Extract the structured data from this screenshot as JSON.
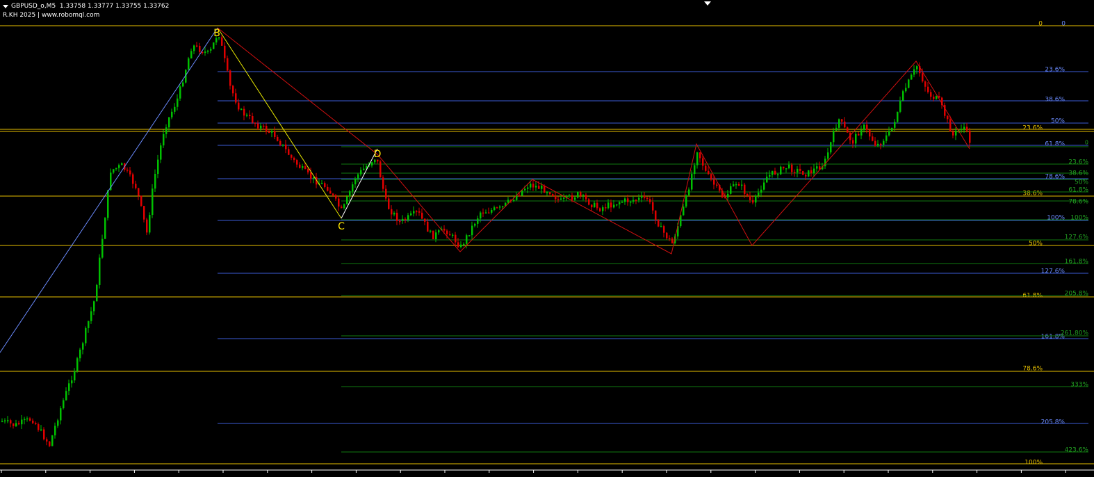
{
  "header": {
    "symbol": "GBPUSD_o,M5",
    "ohlc": "1.33758 1.33777 1.33755 1.33762",
    "watermark": "R.KH 2025 | www.robomql.com"
  },
  "colors": {
    "background": "#000000",
    "bull": "#00c000",
    "bear": "#e00000",
    "fib_gold": "#e8c100",
    "fib_blue": "#3b5bd6",
    "fib_blue_text": "#6b8cff",
    "fib_green": "#0f7a0f",
    "fib_green_text": "#22a022",
    "zigzag": "#d01010",
    "xa_line": "#6b8cff",
    "bc_line": "#e8e800",
    "cd_line": "#ffffff",
    "pattern_label": "#ffe600"
  },
  "chart_data": {
    "type": "candlestick",
    "title": "",
    "pattern_points": [
      {
        "label": "B"
      },
      {
        "label": "C"
      },
      {
        "label": "D"
      }
    ],
    "fib_gold": {
      "levels": [
        "0",
        "23.6%",
        "38.6%",
        "50%",
        "61.8%",
        "78.6%",
        "100%"
      ],
      "top_right_label": "0"
    },
    "fib_blue": {
      "levels": [
        "23.6%",
        "38.6%",
        "50%",
        "61.8%",
        "78.6%",
        "100%",
        "127.6%",
        "161.8%",
        "205.8%"
      ]
    },
    "fib_green": {
      "zero_label": "0",
      "levels": [
        "23.6%",
        "38.6%",
        "50%",
        "61.8%",
        "78.6%",
        "100%",
        "127.6%",
        "161.8%",
        "205.8%",
        "261.80%",
        "333%",
        "423.6%"
      ]
    }
  }
}
